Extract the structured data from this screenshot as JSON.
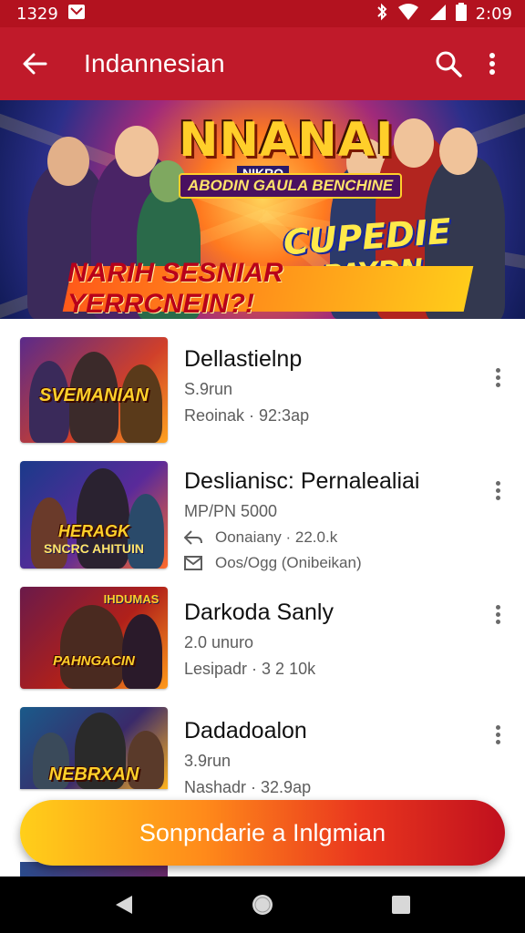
{
  "status_bar": {
    "time_left": "1329",
    "time_right": "2:09"
  },
  "app_bar": {
    "title": "Indannesian",
    "back_icon": "arrow-back-icon",
    "search_icon": "search-icon",
    "menu_icon": "more-vert-icon"
  },
  "banner": {
    "logo": "NNANAI",
    "logo_small": "NIKRO",
    "subtitle": "ABODIN GAULA BENCHINE",
    "logo2_line1": "CUPEDIE",
    "logo2_line2": "PAYDN",
    "strip_text": "NARIH SESNIAR YERRCNEIN?!"
  },
  "items": [
    {
      "name": "Dellastielnp",
      "line1": "S.9run",
      "line2": "Reoinak · 92:3ap",
      "thumb_text": "SVEMANIAN",
      "accent": "#ff7a1f"
    },
    {
      "name": "Deslianisc: Pernalealiai",
      "line1": "MP/PN 5000",
      "line2": "Oonaiany · 22.0.k",
      "line3": "Oos/Ogg (Onibeikan)",
      "thumb_text": "HERAGK",
      "thumb_text2": "SNCRC AHITUIN",
      "accent": "#3a8ad6"
    },
    {
      "name": "Darkoda Sanly",
      "line1": "2.0 unuro",
      "line2": "Lesipadr · 3 2 10k",
      "thumb_text": "PAHNGACIN",
      "thumb_text_top": "IHDUMAS",
      "accent": "#d12a2a"
    },
    {
      "name": "Dadadoalon",
      "line1": "3.9run",
      "line2": "Nashadr · 32.9ap",
      "thumb_text": "NEBRXAN",
      "accent": "#ffb41f"
    }
  ],
  "cta": {
    "label": "Sonpndarie a Inlgmian"
  },
  "colors": {
    "app_bar": "#c01a2a",
    "status_bar": "#b3121f",
    "cta_start": "#ffcf1a",
    "cta_end": "#c0101e"
  }
}
